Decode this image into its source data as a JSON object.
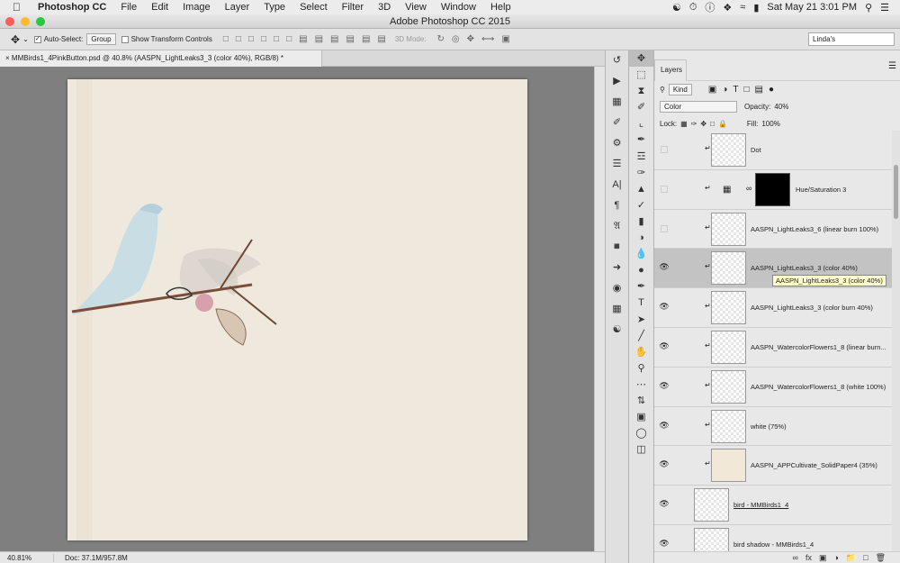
{
  "menubar": {
    "app": "Photoshop CC",
    "items": [
      "File",
      "Edit",
      "Image",
      "Layer",
      "Type",
      "Select",
      "Filter",
      "3D",
      "View",
      "Window",
      "Help"
    ],
    "clock": "Sat May 21  3:01 PM"
  },
  "window": {
    "title": "Adobe Photoshop CC 2015"
  },
  "options": {
    "auto_select_label": "Auto-Select:",
    "auto_select_value": "Group",
    "show_transform": "Show Transform Controls",
    "mode_3d": "3D Mode:",
    "workspace": "Linda's"
  },
  "document": {
    "tab_title": "MMBirds1_4PinkButton.psd @ 40.8% (AASPN_LightLeaks3_3 (color 40%), RGB/8) *",
    "zoom": "40.81%",
    "doc_size": "Doc: 37.1M/957.8M"
  },
  "layers_panel": {
    "tab": "Layers",
    "filter": "Kind",
    "blend_mode": "Color",
    "opacity_label": "Opacity:",
    "opacity": "40%",
    "lock_label": "Lock:",
    "fill_label": "Fill:",
    "fill": "100%",
    "layers": [
      {
        "name": "Dot"
      },
      {
        "name": "Hue/Saturation 3"
      },
      {
        "name": "AASPN_LightLeaks3_6 (linear burn 100%)"
      },
      {
        "name": "AASPN_LightLeaks3_3 (color 40%)"
      },
      {
        "name": "AASPN_LightLeaks3_3 (color burn 40%)"
      },
      {
        "name": "AASPN_WatercolorFlowers1_8 (linear burn..."
      },
      {
        "name": "AASPN_WatercolorFlowers1_8 (white 100%)"
      },
      {
        "name": "white (75%)"
      },
      {
        "name": "AASPN_APPCultivate_SolidPaper4 (35%)"
      },
      {
        "name": "bird - MMBirds1_4"
      },
      {
        "name": "bird shadow - MMBirds1_4"
      }
    ],
    "tooltip": "AASPN_LightLeaks3_3 (color 40%)"
  },
  "colors": {
    "close": "#fc5f57",
    "minimize": "#fdbc2e",
    "zoom": "#28c840",
    "selected_layer": "#c3c3c3"
  }
}
